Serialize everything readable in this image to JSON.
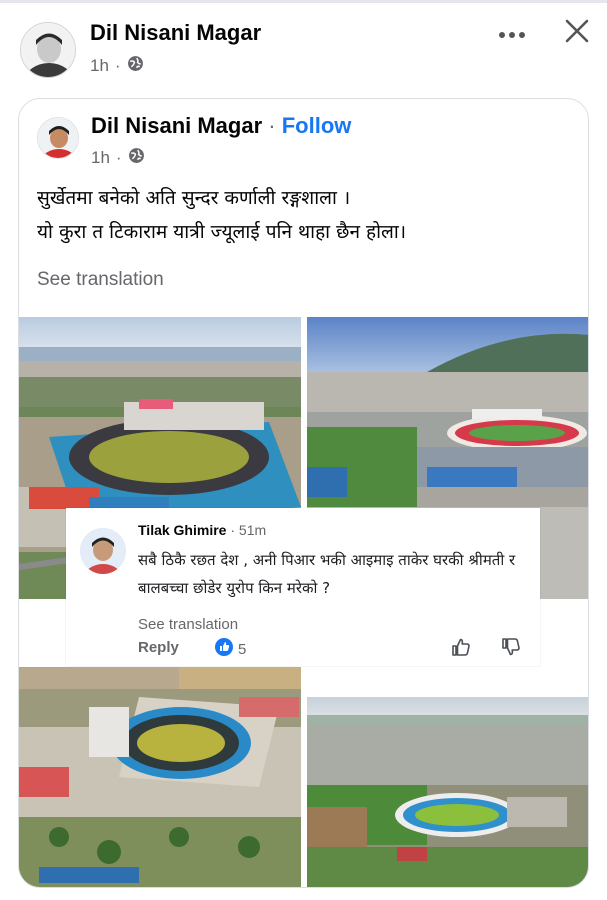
{
  "outer_post": {
    "author": "Dil Nisani Magar",
    "time": "1h",
    "separator": "·"
  },
  "shared_post": {
    "author": "Dil Nisani Magar",
    "name_sep": "·",
    "follow_label": "Follow",
    "time": "1h",
    "separator": "·",
    "text_line1": "सुर्खेतमा बनेको अति सुन्दर  कर्णाली रङ्गशाला ।",
    "text_line2": "यो कुरा त  टिकाराम यात्री ज्यूलाई पनि थाहा छैन होला।",
    "see_translation": "See translation"
  },
  "comment": {
    "author": "Tilak Ghimire",
    "separator": "·",
    "time": "51m",
    "text": "सबै ठिकै रछत देश , अनी पिआर भकी आइमाइ ताकेर घरकी श्रीमती र बालबच्चा छोडेर युरोप किन मरेको ?",
    "see_translation": "See translation",
    "reply_label": "Reply",
    "like_count": "5"
  },
  "icons": {
    "globe": "globe-icon",
    "more": "more-dots-icon",
    "close": "close-icon",
    "like_badge": "like-badge-icon",
    "thumbs_up": "thumbs-up-icon",
    "thumbs_down": "thumbs-down-icon"
  },
  "colors": {
    "brand_blue": "#1877f2",
    "secondary_text": "#65676b"
  }
}
